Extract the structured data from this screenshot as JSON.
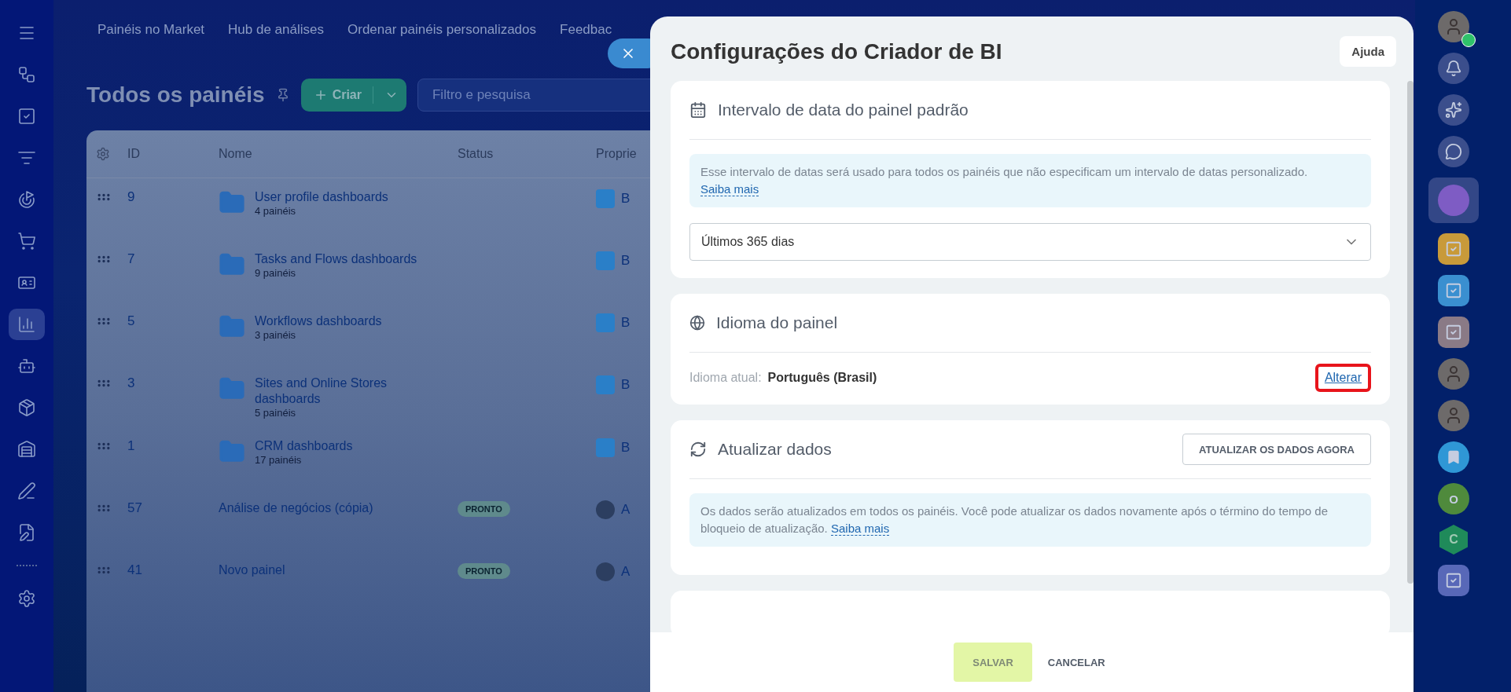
{
  "top_nav": [
    {
      "label": "Painéis no Market"
    },
    {
      "label": "Hub de análises"
    },
    {
      "label": "Ordenar painéis personalizados"
    },
    {
      "label": "Feedbac"
    }
  ],
  "sidebar": {
    "items": [
      {
        "kind": "menu",
        "selected": false
      },
      {
        "kind": "nodes",
        "selected": false
      },
      {
        "kind": "task",
        "selected": false
      },
      {
        "kind": "funnel",
        "selected": false
      },
      {
        "kind": "target",
        "selected": false
      },
      {
        "kind": "cart",
        "selected": false
      },
      {
        "kind": "card",
        "selected": false
      },
      {
        "kind": "chart",
        "selected": true
      },
      {
        "kind": "bot",
        "selected": false
      },
      {
        "kind": "box",
        "selected": false
      },
      {
        "kind": "store",
        "selected": false
      },
      {
        "kind": "pen",
        "selected": false
      },
      {
        "kind": "document",
        "selected": false
      }
    ],
    "bottom_items": [
      {
        "kind": "gear",
        "selected": false
      }
    ]
  },
  "page": {
    "title": "Todos os painéis",
    "create_button": "Criar",
    "search": {
      "placeholder": "Filtro e pesquisa"
    }
  },
  "table": {
    "columns": [
      "ID",
      "Nome",
      "Status",
      "Proprie"
    ],
    "rows": [
      {
        "kind": "folder",
        "id": "9",
        "name": "User profile dashboards",
        "count": "4 painéis",
        "owner": "B"
      },
      {
        "kind": "folder",
        "id": "7",
        "name": "Tasks and Flows dashboards",
        "count": "9 painéis",
        "owner": "B"
      },
      {
        "kind": "folder",
        "id": "5",
        "name": "Workflows dashboards",
        "count": "3 painéis",
        "owner": "B"
      },
      {
        "kind": "folder",
        "id": "3",
        "name": "Sites and Online Stores dashboards",
        "count": "5 painéis",
        "owner": "B"
      },
      {
        "kind": "folder",
        "id": "1",
        "name": "CRM dashboards",
        "count": "17 painéis",
        "owner": "B"
      },
      {
        "kind": "dashboard",
        "id": "57",
        "name": "Análise de negócios (cópia)",
        "status": "PRONTO",
        "owner": "A"
      },
      {
        "kind": "dashboard",
        "id": "41",
        "name": "Novo painel",
        "status": "PRONTO",
        "owner": "A"
      }
    ]
  },
  "modal": {
    "title": "Configurações do Criador de BI",
    "help_button": "Ajuda",
    "sections": [
      {
        "kind": "date_range",
        "title": "Intervalo de data do painel padrão",
        "info": {
          "text": "Esse intervalo de datas será usado para todos os painéis que não especificam um intervalo de datas personalizado.",
          "link": "Saiba mais"
        },
        "select": {
          "value": "Últimos 365 dias"
        }
      },
      {
        "kind": "language",
        "title": "Idioma do painel",
        "label": "Idioma atual:",
        "value": "Português (Brasil)",
        "action": {
          "label": "Alterar",
          "highlighted": true
        }
      },
      {
        "kind": "refresh",
        "title": "Atualizar dados",
        "button": "ATUALIZAR OS DADOS AGORA",
        "info": {
          "text": "Os dados serão atualizados em todos os painéis. Você pode atualizar os dados novamente após o término do tempo de bloqueio de atualização.",
          "link": "Saiba mais"
        }
      },
      {
        "kind": "partial"
      }
    ],
    "footer": {
      "save": {
        "label": "SALVAR",
        "disabled": true
      },
      "cancel": "CANCELAR"
    }
  },
  "right_rail": [
    {
      "kind": "avatar",
      "online": true
    },
    {
      "kind": "bell"
    },
    {
      "kind": "sparkle"
    },
    {
      "kind": "chat"
    },
    {
      "kind": "app",
      "selected": true
    },
    {
      "kind": "task",
      "color": "#c89a3a"
    },
    {
      "kind": "task",
      "color": "#3a8fd0"
    },
    {
      "kind": "task",
      "color": "#8a7a86"
    },
    {
      "kind": "avatar",
      "online": false
    },
    {
      "kind": "avatar",
      "online": false
    },
    {
      "kind": "bookmark",
      "color": "#2f97d6"
    },
    {
      "kind": "letter",
      "text": "O",
      "color": "#4f8a3c"
    },
    {
      "kind": "hex",
      "text": "C",
      "color": "#1f8a5a"
    },
    {
      "kind": "task",
      "color": "#5868b8"
    }
  ]
}
